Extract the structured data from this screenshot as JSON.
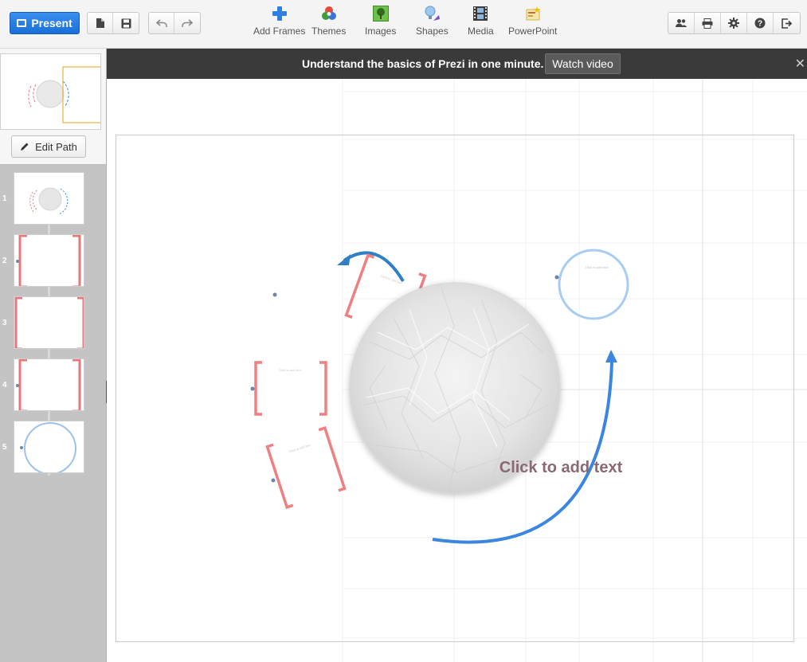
{
  "toolbar": {
    "present_label": "Present",
    "insert_items": [
      {
        "label": "Add Frames",
        "icon": "add-frames-icon"
      },
      {
        "label": "Themes",
        "icon": "themes-icon"
      },
      {
        "label": "Images",
        "icon": "images-icon"
      },
      {
        "label": "Shapes",
        "icon": "shapes-icon"
      },
      {
        "label": "Media",
        "icon": "media-icon"
      },
      {
        "label": "PowerPoint",
        "icon": "powerpoint-icon"
      }
    ]
  },
  "banner": {
    "text": "Understand the basics of Prezi in one minute.",
    "button_label": "Watch video",
    "close_symbol": "✕"
  },
  "sidebar": {
    "edit_path_label": "Edit Path",
    "slides": [
      {
        "number": "1",
        "kind": "overview"
      },
      {
        "number": "2",
        "kind": "bracket-frame"
      },
      {
        "number": "3",
        "kind": "bracket-frame"
      },
      {
        "number": "4",
        "kind": "bracket-frame"
      },
      {
        "number": "5",
        "kind": "circle-frame"
      }
    ]
  },
  "canvas": {
    "center_placeholder": "Click to add text"
  },
  "colors": {
    "accent_blue": "#1a6fd8",
    "bracket_red": "#e8777a",
    "arrow_blue": "#3a86e0",
    "circle_blue": "#9cc3f0"
  }
}
